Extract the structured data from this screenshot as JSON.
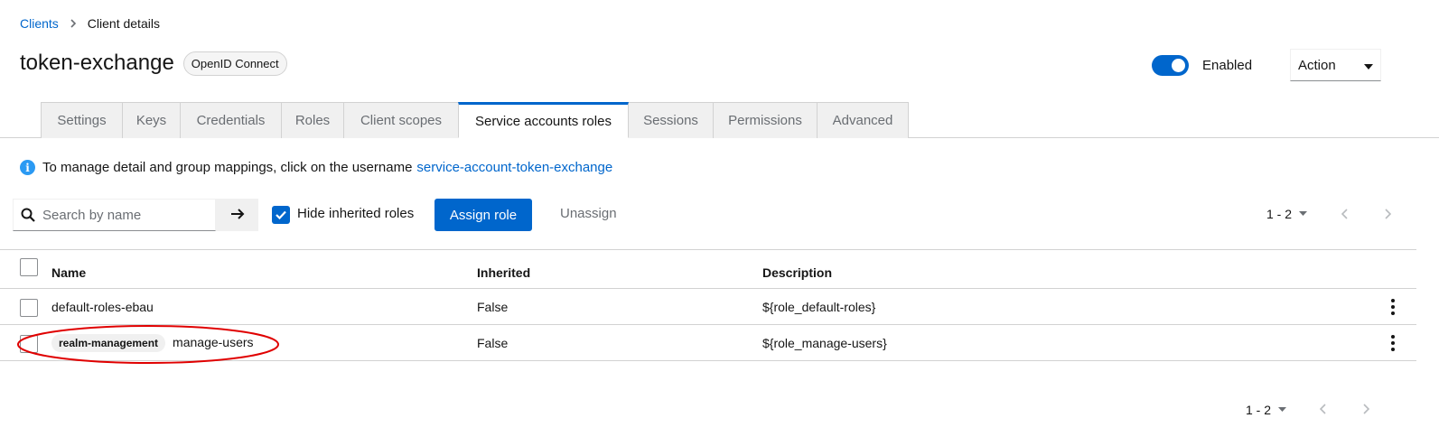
{
  "breadcrumb": {
    "parent": "Clients",
    "current": "Client details"
  },
  "header": {
    "title": "token-exchange",
    "protocol_badge": "OpenID Connect",
    "enabled_label": "Enabled",
    "action_label": "Action"
  },
  "tabs": [
    {
      "label": "Settings"
    },
    {
      "label": "Keys"
    },
    {
      "label": "Credentials"
    },
    {
      "label": "Roles"
    },
    {
      "label": "Client scopes"
    },
    {
      "label": "Service accounts roles"
    },
    {
      "label": "Sessions"
    },
    {
      "label": "Permissions"
    },
    {
      "label": "Advanced"
    }
  ],
  "info": {
    "text": "To manage detail and group mappings, click on the username",
    "link": "service-account-token-exchange"
  },
  "toolbar": {
    "search_placeholder": "Search by name",
    "hide_inherited_label": "Hide inherited roles",
    "assign_label": "Assign role",
    "unassign_label": "Unassign",
    "pagination": "1 - 2"
  },
  "table": {
    "headers": {
      "name": "Name",
      "inherited": "Inherited",
      "description": "Description"
    },
    "rows": [
      {
        "client": "",
        "name": "default-roles-ebau",
        "inherited": "False",
        "description": "${role_default-roles}"
      },
      {
        "client": "realm-management",
        "name": "manage-users",
        "inherited": "False",
        "description": "${role_manage-users}"
      }
    ]
  },
  "footer": {
    "pagination": "1 - 2"
  },
  "colors": {
    "primary": "#0066cc",
    "annotation": "#e00000"
  }
}
